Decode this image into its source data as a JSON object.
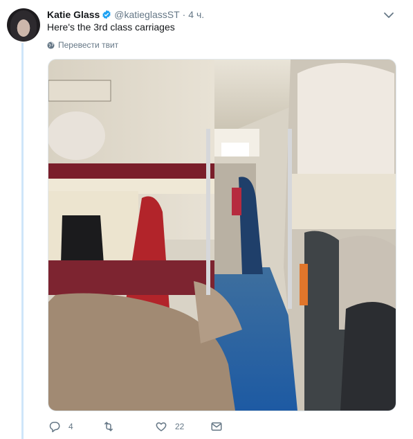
{
  "tweet": {
    "author_name": "Katie Glass",
    "handle": "@katieglassST",
    "separator": "·",
    "time": "4 ч.",
    "text": "Here's the 3rd class carriages",
    "translate_label": "Перевести твит",
    "image_alt": "Interior of a 3rd class train carriage with bunks and luggage"
  },
  "actions": {
    "reply_count": "4",
    "retweet_count": "",
    "like_count": "22"
  },
  "colors": {
    "verified": "#1da1f2",
    "secondary_text": "#657786",
    "thread_line": "#cfe6fa"
  }
}
